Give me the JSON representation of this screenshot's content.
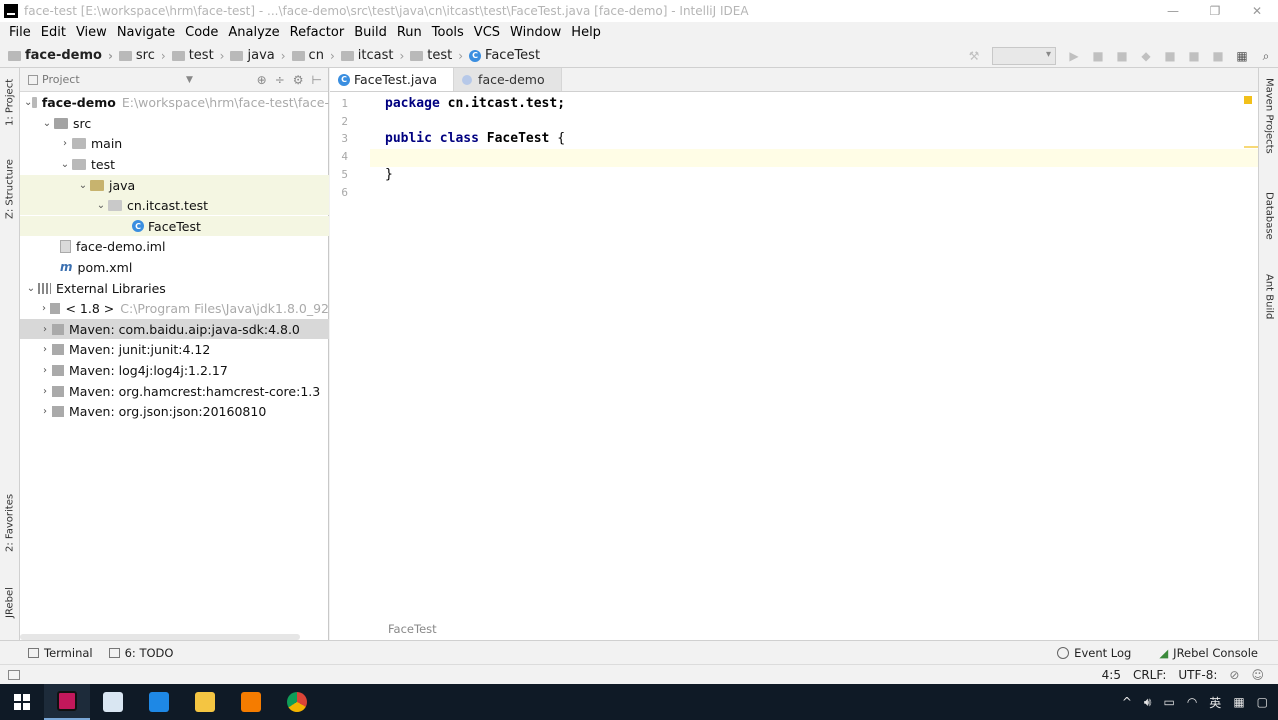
{
  "window": {
    "title": "face-test [E:\\workspace\\hrm\\face-test] - ...\\face-demo\\src\\test\\java\\cn\\itcast\\test\\FaceTest.java [face-demo] - IntelliJ IDEA",
    "minimize": "—",
    "restore": "❐",
    "close": "✕"
  },
  "menu": [
    "File",
    "Edit",
    "View",
    "Navigate",
    "Code",
    "Analyze",
    "Refactor",
    "Build",
    "Run",
    "Tools",
    "VCS",
    "Window",
    "Help"
  ],
  "breadcrumb": [
    "face-demo",
    "src",
    "test",
    "java",
    "cn",
    "itcast",
    "test",
    "FaceTest"
  ],
  "left_strip": {
    "project": "1: Project",
    "structure": "Z: Structure",
    "favorites": "2: Favorites",
    "jrebel": "JRebel"
  },
  "right_strip": {
    "maven": "Maven Projects",
    "database": "Database",
    "ant": "Ant Build"
  },
  "project_panel": {
    "title": "Project",
    "tree": [
      {
        "label": "face-demo",
        "extra": "E:\\workspace\\hrm\\face-test\\face-"
      },
      {
        "label": "src"
      },
      {
        "label": "main"
      },
      {
        "label": "test"
      },
      {
        "label": "java"
      },
      {
        "label": "cn.itcast.test"
      },
      {
        "label": "FaceTest"
      },
      {
        "label": "face-demo.iml"
      },
      {
        "label": "pom.xml"
      },
      {
        "label": "External Libraries"
      },
      {
        "label": "< 1.8 >",
        "extra": "C:\\Program Files\\Java\\jdk1.8.0_92"
      },
      {
        "label": "Maven: com.baidu.aip:java-sdk:4.8.0"
      },
      {
        "label": "Maven: junit:junit:4.12"
      },
      {
        "label": "Maven: log4j:log4j:1.2.17"
      },
      {
        "label": "Maven: org.hamcrest:hamcrest-core:1.3"
      },
      {
        "label": "Maven: org.json:json:20160810"
      }
    ]
  },
  "editor": {
    "tabs": [
      "FaceTest.java",
      "face-demo"
    ],
    "line_numbers": [
      "1",
      "2",
      "3",
      "4",
      "5",
      "6"
    ],
    "code": {
      "l1_kw": "package",
      "l1_rest": " cn.itcast.test;",
      "l3_kw1": "public",
      "l3_kw2": "class",
      "l3_name": "FaceTest",
      "l3_brace": " {",
      "l5": "}"
    },
    "footer": "FaceTest"
  },
  "bottom_tools": {
    "terminal": "Terminal",
    "todo": "6: TODO",
    "event_log": "Event Log",
    "jrebel_console": "JRebel Console"
  },
  "status": {
    "position": "4:5",
    "line_sep": "CRLF:",
    "encoding": "UTF-8:"
  },
  "tray": {
    "ime": "英",
    "chevron": "^"
  },
  "colors": {
    "keyword": "#000080",
    "selection_hl": "#f4f6e2",
    "taskbar": "#0f1a26"
  }
}
